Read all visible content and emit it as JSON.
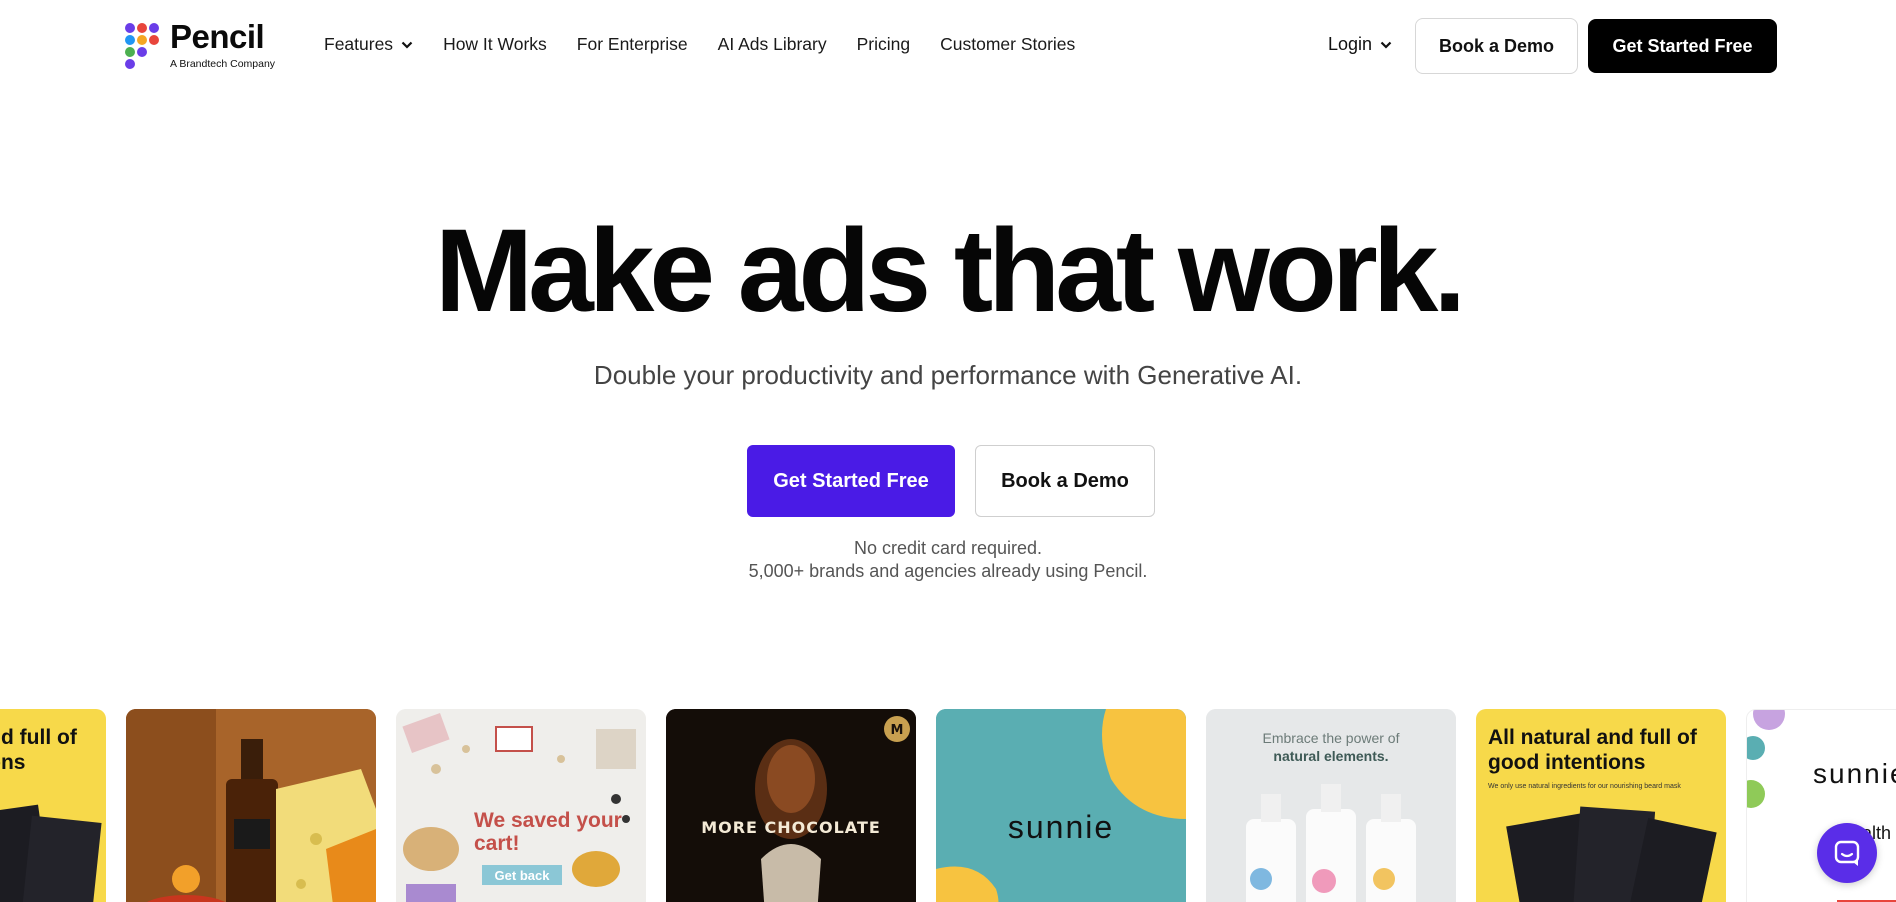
{
  "brand": {
    "name": "Pencil",
    "tagline": "A Brandtech Company",
    "logo_colors": [
      "#e8453c",
      "#f5a623",
      "#4caf50",
      "#2196f3",
      "#6a3de8"
    ]
  },
  "nav": {
    "items": [
      {
        "label": "Features",
        "has_dropdown": true
      },
      {
        "label": "How It Works"
      },
      {
        "label": "For Enterprise"
      },
      {
        "label": "AI Ads Library"
      },
      {
        "label": "Pricing"
      },
      {
        "label": "Customer Stories"
      }
    ],
    "login_label": "Login",
    "demo_label": "Book a Demo",
    "start_label": "Get Started Free"
  },
  "hero": {
    "title": "Make ads that work.",
    "subtitle": "Double your productivity and performance with Generative AI.",
    "primary_cta": "Get Started Free",
    "secondary_cta": "Book a Demo",
    "note_line1": "No credit card required.",
    "note_line2": "5,000+ brands and agencies already using Pencil.",
    "accent_color": "#4a1be6"
  },
  "gallery": {
    "card0": {
      "headline": "All natural and full of good intentions"
    },
    "card2": {
      "headline": "We saved your cart!",
      "button": "Get back"
    },
    "card3": {
      "headline": "MORE CHOCOLATE"
    },
    "card4": {
      "brand": "sunnie"
    },
    "card5": {
      "line1": "Embrace the power of",
      "line2": "natural elements."
    },
    "card6": {
      "headline": "All natural and full of good intentions",
      "sub": "We only use natural ingredients for our nourishing beard mask"
    },
    "card7": {
      "brand": "sunnie",
      "text": "Health kids daily"
    }
  },
  "chat": {
    "icon": "chat-icon"
  }
}
